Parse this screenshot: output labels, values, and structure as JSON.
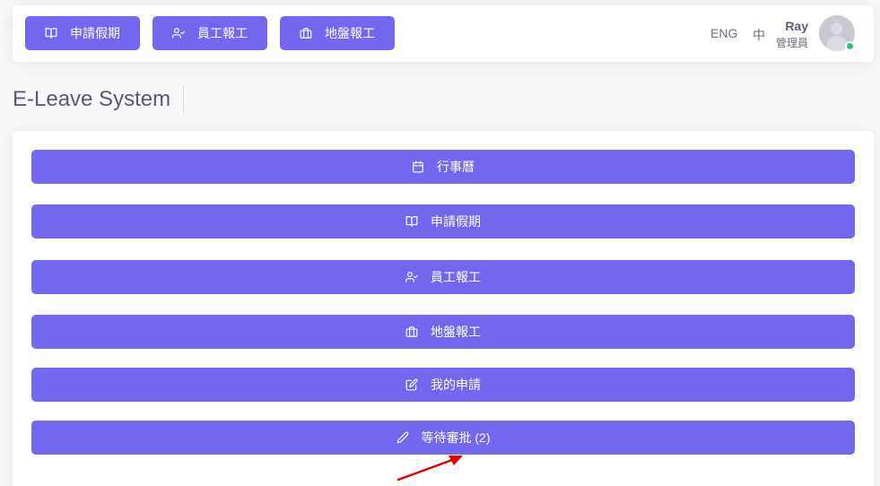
{
  "navbar": {
    "buttons": [
      {
        "label": "申請假期",
        "icon": "book-icon"
      },
      {
        "label": "員工報工",
        "icon": "user-check-icon"
      },
      {
        "label": "地盤報工",
        "icon": "briefcase-icon"
      }
    ],
    "lang_eng": "ENG",
    "lang_zh": "中",
    "user": {
      "name": "Ray",
      "role": "管理員",
      "status_color": "#28c76f"
    }
  },
  "page": {
    "title": "E-Leave System"
  },
  "menu": [
    {
      "label": "行事曆",
      "icon": "calendar-icon"
    },
    {
      "label": "申請假期",
      "icon": "book-icon"
    },
    {
      "label": "員工報工",
      "icon": "user-check-icon"
    },
    {
      "label": "地盤報工",
      "icon": "briefcase-icon"
    },
    {
      "label": "我的申請",
      "icon": "edit-icon"
    },
    {
      "label": "等待審批 (2)",
      "icon": "pencil-icon"
    }
  ],
  "colors": {
    "primary": "#7367f0",
    "annotation_arrow": "#e00000"
  }
}
